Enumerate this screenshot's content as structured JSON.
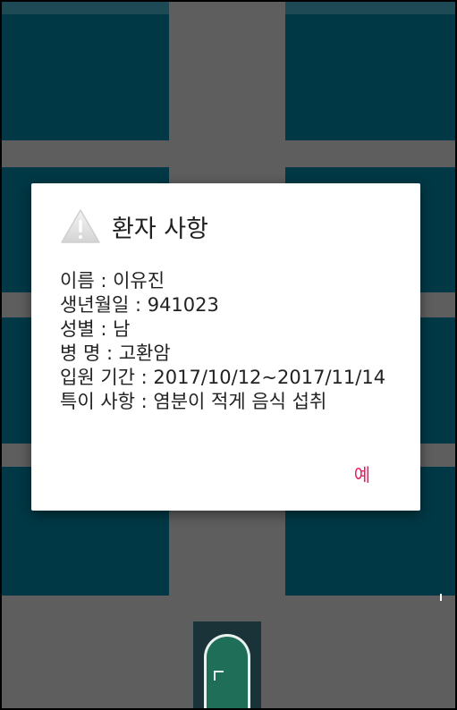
{
  "dialog": {
    "title": "환자 사항",
    "icon": "warning-icon",
    "lines": [
      "이름 : 이유진",
      "생년월일 : 941023",
      "성별 : 남",
      "병 명 : 고환암",
      "입원 기간 : 2017/10/12~2017/11/14",
      "특이 사항 : 염분이 적게 음식 섭취"
    ],
    "ok_label": "예"
  },
  "colors": {
    "room": "#003845",
    "corridor": "#5e5e5e",
    "accent": "#e91e63",
    "door": "#1e6e58"
  }
}
